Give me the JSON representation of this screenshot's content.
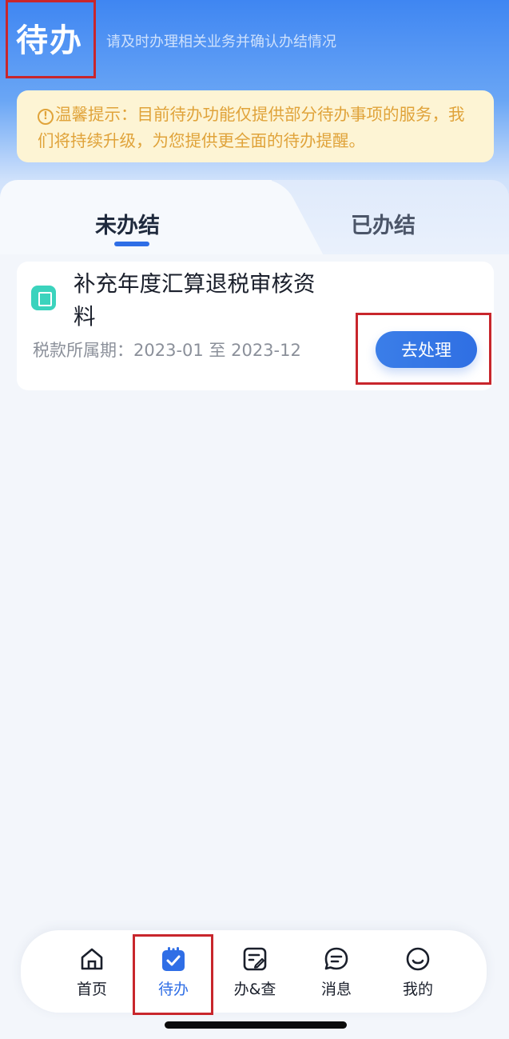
{
  "header": {
    "title": "待办",
    "subtitle": "请及时办理相关业务并确认办结情况"
  },
  "notice": {
    "icon": "info-circle-icon",
    "text": "温馨提示：目前待办功能仅提供部分待办事项的服务，我们将持续升级，为您提供更全面的待办提醒。"
  },
  "tabs": [
    {
      "label": "未办结",
      "active": true
    },
    {
      "label": "已办结",
      "active": false
    }
  ],
  "tasks": [
    {
      "title": "补充年度汇算退税审核资料",
      "period": "税款所属期：2023-01 至 2023-12",
      "action_label": "去处理"
    }
  ],
  "bottom_nav": [
    {
      "label": "首页",
      "icon": "home-icon",
      "active": false
    },
    {
      "label": "待办",
      "icon": "todo-calendar-icon",
      "active": true
    },
    {
      "label": "办&查",
      "icon": "document-edit-icon",
      "active": false
    },
    {
      "label": "消息",
      "icon": "message-icon",
      "active": false
    },
    {
      "label": "我的",
      "icon": "smile-face-icon",
      "active": false
    }
  ],
  "colors": {
    "primary": "#2f6ee6",
    "notice_bg": "#fdf4d4",
    "notice_text": "#e0a33a",
    "highlight": "#c8262c"
  }
}
